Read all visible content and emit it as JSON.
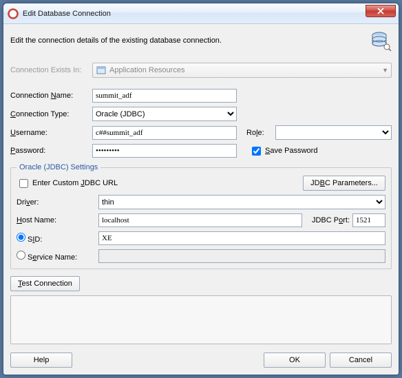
{
  "window": {
    "title": "Edit Database Connection"
  },
  "description": "Edit the connection details of the existing database connection.",
  "exists_in": {
    "label": "Connection Exists In:",
    "value": "Application Resources"
  },
  "fields": {
    "connection_name": {
      "label": "Connection Name:",
      "value": "summit_adf"
    },
    "connection_type": {
      "label": "Connection Type:",
      "value": "Oracle (JDBC)"
    },
    "username": {
      "label": "Username:",
      "value": "c##summit_adf"
    },
    "password": {
      "label": "Password:",
      "value": "•••••••••"
    },
    "role": {
      "label": "Role:"
    },
    "save_password": {
      "label": "Save Password",
      "checked": true
    }
  },
  "jdbc": {
    "legend": "Oracle (JDBC) Settings",
    "custom_url": {
      "label": "Enter Custom JDBC URL",
      "checked": false
    },
    "params_btn": "JDBC Parameters...",
    "driver": {
      "label": "Driver:",
      "value": "thin"
    },
    "host": {
      "label": "Host Name:",
      "value": "localhost"
    },
    "port": {
      "label": "JDBC Port:",
      "value": "1521"
    },
    "sid": {
      "label": "SID:",
      "value": "XE",
      "selected": true
    },
    "service": {
      "label": "Service Name:",
      "value": ""
    }
  },
  "buttons": {
    "test": "Test Connection",
    "help": "Help",
    "ok": "OK",
    "cancel": "Cancel"
  }
}
